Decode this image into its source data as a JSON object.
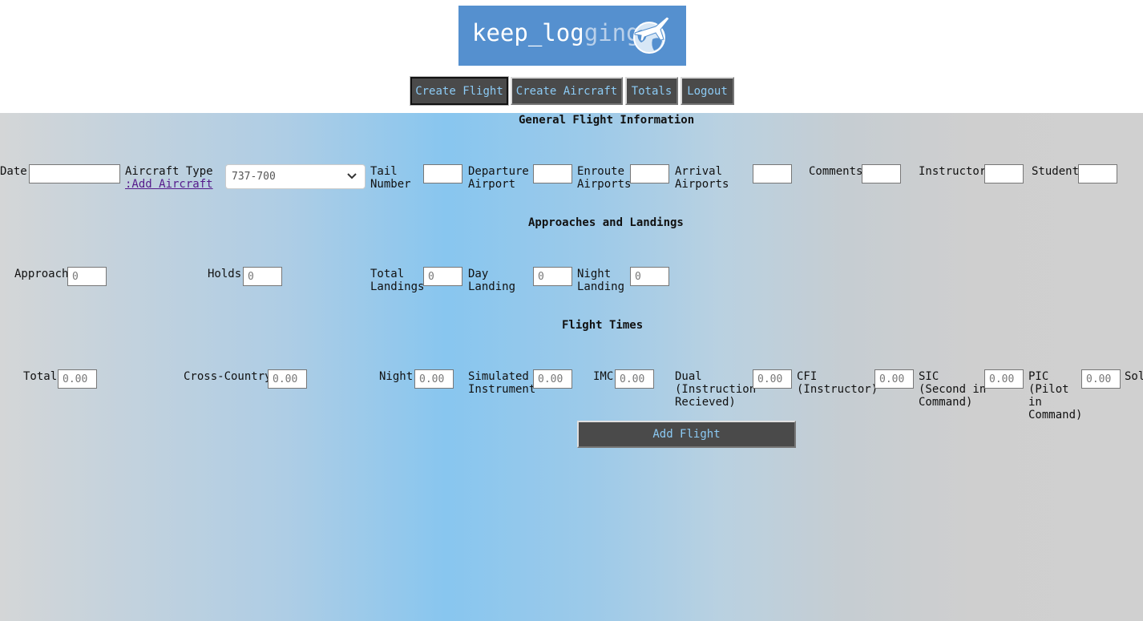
{
  "header": {
    "logo_text_main": "keep_log",
    "logo_text_ghost": "ging",
    "brand_color": "#5590cf"
  },
  "nav": {
    "create_flight": "Create Flight",
    "create_aircraft": "Create Aircraft",
    "totals": "Totals",
    "logout": "Logout",
    "button_bg": "#4a4a4a",
    "button_text_color": "#8ccbf5"
  },
  "general": {
    "title": "General Flight Information",
    "date_label": "Date",
    "date_value": "",
    "aircraft_type_label": "Aircraft Type",
    "add_aircraft_link": ":Add Aircraft",
    "aircraft_selected": "737-700",
    "tail_label_1": "Tail",
    "tail_label_2": "Number",
    "departure_label_1": "Departure",
    "departure_label_2": "Airport",
    "enroute_label_1": "Enroute",
    "enroute_label_2": "Airports",
    "arrival_label_1": "Arrival",
    "arrival_label_2": "Airports",
    "comments_label": "Comments",
    "instructor_label": "Instructor",
    "student_label": "Student"
  },
  "approaches": {
    "title": "Approaches and Landings",
    "approach_label": "Approach",
    "approach_value": "0",
    "holds_label": "Holds",
    "holds_value": "0",
    "total_landings_label_1": "Total",
    "total_landings_label_2": "Landings",
    "total_landings_value": "0",
    "day_landing_label_1": "Day",
    "day_landing_label_2": "Landing",
    "day_landing_value": "0",
    "night_landing_label_1": "Night",
    "night_landing_label_2": "Landing",
    "night_landing_value": "0"
  },
  "times": {
    "title": "Flight Times",
    "total_label": "Total",
    "total_value": "0.00",
    "cross_country_label": "Cross-Country",
    "cross_country_value": "0.00",
    "night_label": "Night",
    "night_value": "0.00",
    "sim_label_1": "Simulated",
    "sim_label_2": "Instrument",
    "sim_value": "0.00",
    "imc_label": "IMC",
    "imc_value": "0.00",
    "dual_label_1": "Dual",
    "dual_label_2": "(Instruction",
    "dual_label_3": "Recieved)",
    "dual_value": "0.00",
    "cfi_label_1": "CFI",
    "cfi_label_2": "(Instructor)",
    "cfi_value": "0.00",
    "sic_label_1": "SIC",
    "sic_label_2": "(Second in",
    "sic_label_3": "Command)",
    "sic_value": "0.00",
    "pic_label_1": "PIC",
    "pic_label_2": "(Pilot",
    "pic_label_3": "in",
    "pic_label_4": "Command)",
    "pic_value": "0.00",
    "solo_label_partial": "Sol"
  },
  "actions": {
    "add_flight": "Add Flight"
  }
}
